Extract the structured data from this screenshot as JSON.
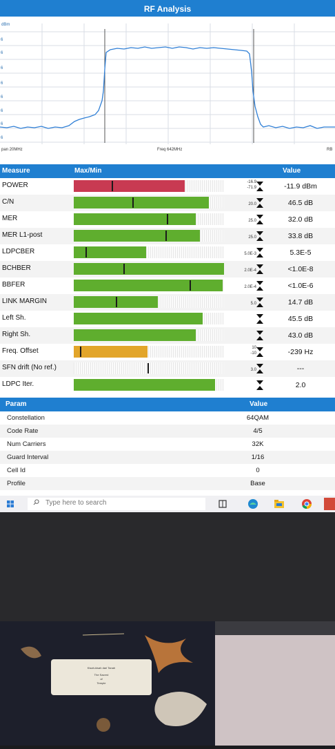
{
  "window": {
    "title": "RF Analysis"
  },
  "spectrum": {
    "unit_label": "dBm",
    "y_ticks": [
      "6",
      "6",
      "6",
      "6",
      "6",
      "6",
      "6",
      "6"
    ],
    "span_label": "pan 20MHz",
    "freq_label": "Freq 642MHz",
    "right_label": "RB",
    "trace_color": "#2f7fd6"
  },
  "measure_table": {
    "headers": {
      "measure": "Measure",
      "maxmin": "Max/Min",
      "value": "Value"
    },
    "rows": [
      {
        "name": "POWER",
        "limit_top": "-16.9",
        "limit_bottom": "-71.9",
        "value": "-11.9 dBm",
        "color": "#c83a52",
        "level": 0.74
      },
      {
        "name": "C/N",
        "limit_top": "",
        "limit_bottom": "20.0",
        "value": "46.5 dB",
        "color": "#5fae2e",
        "level": 0.9
      },
      {
        "name": "MER",
        "limit_top": "",
        "limit_bottom": "25.0",
        "value": "32.0 dB",
        "color": "#5fae2e",
        "level": 0.81
      },
      {
        "name": "MER L1-post",
        "limit_top": "",
        "limit_bottom": "25.0",
        "value": "33.8 dB",
        "color": "#5fae2e",
        "level": 0.84
      },
      {
        "name": "LDPCBER",
        "limit_top": "",
        "limit_bottom": "5.0E-3",
        "value": "5.3E-5",
        "color": "#5fae2e",
        "level": 0.48
      },
      {
        "name": "BCHBER",
        "limit_top": "",
        "limit_bottom": "2.0E-4",
        "value": "<1.0E-8",
        "color": "#5fae2e",
        "level": 1.0
      },
      {
        "name": "BBFER",
        "limit_top": "",
        "limit_bottom": "2.0E-4",
        "value": "<1.0E-6",
        "color": "#5fae2e",
        "level": 0.99
      },
      {
        "name": "LINK MARGIN",
        "limit_top": "",
        "limit_bottom": "5.0",
        "value": "14.7 dB",
        "color": "#5fae2e",
        "level": 0.56
      },
      {
        "name": "Left Sh.",
        "limit_top": "",
        "limit_bottom": "",
        "value": "45.5 dB",
        "color": "#5fae2e",
        "level": 0.86
      },
      {
        "name": "Right Sh.",
        "limit_top": "",
        "limit_bottom": "",
        "value": "43.0 dB",
        "color": "#5fae2e",
        "level": 0.81
      },
      {
        "name": "Freq. Offset",
        "limit_top": "10",
        "limit_bottom": "-10",
        "value": "-239 Hz",
        "color": "#e2a52a",
        "level": 0.49
      },
      {
        "name": "SFN drift (No ref.)",
        "limit_top": "",
        "limit_bottom": "3.0",
        "value": "---",
        "color": "#5fae2e",
        "level": 0.0
      },
      {
        "name": "LDPC Iter.",
        "limit_top": "",
        "limit_bottom": "",
        "value": "2.0",
        "color": "#5fae2e",
        "level": 0.94
      }
    ]
  },
  "param_table": {
    "headers": {
      "param": "Param",
      "value": "Value"
    },
    "rows": [
      {
        "name": "Constellation",
        "value": "64QAM"
      },
      {
        "name": "Code Rate",
        "value": "4/5"
      },
      {
        "name": "Num Carriers",
        "value": "32K"
      },
      {
        "name": "Guard Interval",
        "value": "1/16"
      },
      {
        "name": "Cell Id",
        "value": "0"
      },
      {
        "name": "Profile",
        "value": "Base"
      }
    ]
  },
  "taskbar": {
    "search_placeholder": "Type here to search"
  },
  "desk_card": {
    "line1": "Kisah-kisah dari Tanah",
    "line2": "The Sacred",
    "line3": "of",
    "line4": "Temple"
  }
}
